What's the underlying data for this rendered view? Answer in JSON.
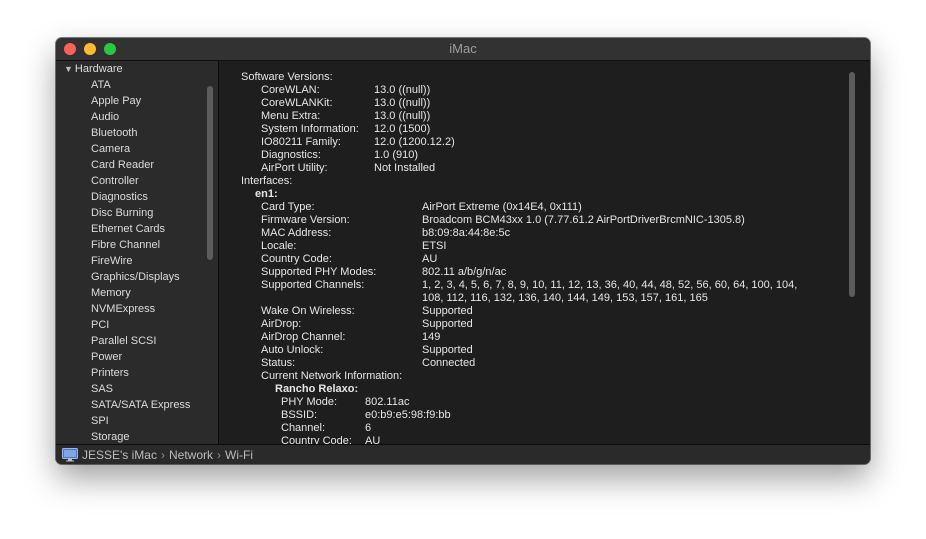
{
  "window": {
    "title": "iMac"
  },
  "sidebar": {
    "header": "Hardware",
    "items": [
      "ATA",
      "Apple Pay",
      "Audio",
      "Bluetooth",
      "Camera",
      "Card Reader",
      "Controller",
      "Diagnostics",
      "Disc Burning",
      "Ethernet Cards",
      "Fibre Channel",
      "FireWire",
      "Graphics/Displays",
      "Memory",
      "NVMExpress",
      "PCI",
      "Parallel SCSI",
      "Power",
      "Printers",
      "SAS",
      "SATA/SATA Express",
      "SPI",
      "Storage"
    ]
  },
  "content": {
    "software_versions": {
      "label": "Software Versions:",
      "rows": [
        {
          "key": "CoreWLAN:",
          "value": "13.0 ((null))"
        },
        {
          "key": "CoreWLANKit:",
          "value": "13.0 ((null))"
        },
        {
          "key": "Menu Extra:",
          "value": "13.0 ((null))"
        },
        {
          "key": "System Information:",
          "value": "12.0 (1500)"
        },
        {
          "key": "IO80211 Family:",
          "value": "12.0 (1200.12.2)"
        },
        {
          "key": "Diagnostics:",
          "value": "1.0 (910)"
        },
        {
          "key": "AirPort Utility:",
          "value": "Not Installed"
        }
      ]
    },
    "interfaces": {
      "label": "Interfaces:",
      "name": "en1:",
      "rows": [
        {
          "key": "Card Type:",
          "value": "AirPort Extreme  (0x14E4, 0x111)"
        },
        {
          "key": "Firmware Version:",
          "value": "Broadcom BCM43xx 1.0 (7.77.61.2 AirPortDriverBrcmNIC-1305.8)"
        },
        {
          "key": "MAC Address:",
          "value": "b8:09:8a:44:8e:5c"
        },
        {
          "key": "Locale:",
          "value": "ETSI"
        },
        {
          "key": "Country Code:",
          "value": "AU"
        },
        {
          "key": "Supported PHY Modes:",
          "value": "802.11 a/b/g/n/ac"
        },
        {
          "key": "Supported Channels:",
          "value": "1, 2, 3, 4, 5, 6, 7, 8, 9, 10, 11, 12, 13, 36, 40, 44, 48, 52, 56, 60, 64, 100, 104,",
          "value2": "108, 112, 116, 132, 136, 140, 144, 149, 153, 157, 161, 165"
        },
        {
          "key": "Wake On Wireless:",
          "value": "Supported"
        },
        {
          "key": "AirDrop:",
          "value": "Supported"
        },
        {
          "key": "AirDrop Channel:",
          "value": "149"
        },
        {
          "key": "Auto Unlock:",
          "value": "Supported"
        },
        {
          "key": "Status:",
          "value": "Connected"
        }
      ],
      "current_network_label": "Current Network Information:",
      "network_name": "Rancho Relaxo:",
      "network_rows": [
        {
          "key": "PHY Mode:",
          "value": "802.11ac"
        },
        {
          "key": "BSSID:",
          "value": "e0:b9:e5:98:f9:bb"
        },
        {
          "key": "Channel:",
          "value": "6"
        },
        {
          "key": "Country Code:",
          "value": "AU"
        }
      ]
    }
  },
  "statusbar": {
    "path": [
      "JESSE's iMac",
      "Network",
      "Wi-Fi"
    ],
    "separator": "›"
  }
}
